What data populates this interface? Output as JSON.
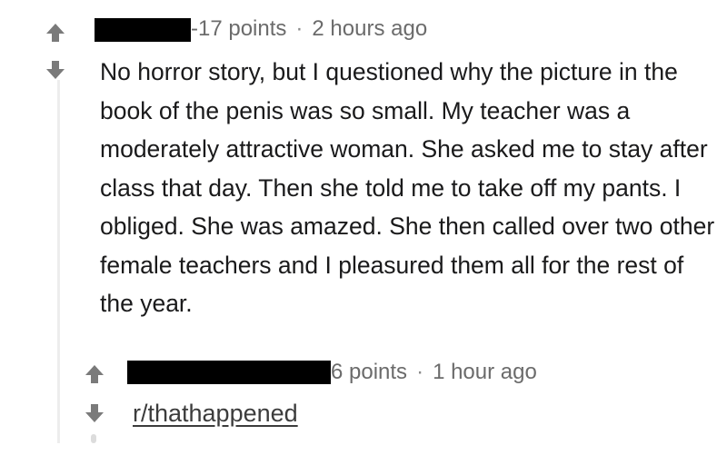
{
  "comments": [
    {
      "points": "-17 points",
      "separator": "·",
      "time": "2 hours ago",
      "body": "No horror story, but I questioned why the picture in the book of the penis was so small. My teacher was a moderately attractive woman. She asked me to stay after class that day. Then she told me to take off my pants. I obliged. She was amazed. She then called over two other female teachers and I pleasured them all for the rest of the year."
    },
    {
      "points": "6 points",
      "separator": "·",
      "time": "1 hour ago",
      "body": "r/thathappened"
    }
  ],
  "icons": {
    "upvote": "arrow-up-icon",
    "downvote": "arrow-down-icon"
  },
  "colors": {
    "arrow": "#7a7a7a",
    "meta_text": "#6b6b6b",
    "redaction": "#000000"
  }
}
